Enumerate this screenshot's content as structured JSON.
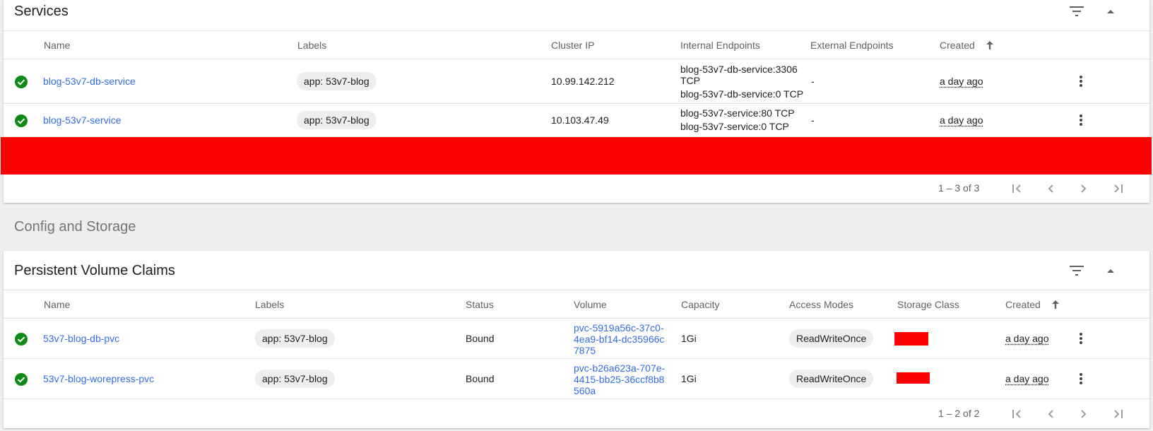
{
  "services": {
    "title": "Services",
    "columns": {
      "name": "Name",
      "labels": "Labels",
      "cluster_ip": "Cluster IP",
      "internal_endpoints": "Internal Endpoints",
      "external_endpoints": "External Endpoints",
      "created": "Created"
    },
    "rows": [
      {
        "name": "blog-53v7-db-service",
        "label": "app: 53v7-blog",
        "cluster_ip": "10.99.142.212",
        "internal_endpoint_1": "blog-53v7-db-service:3306 TCP",
        "internal_endpoint_2": "blog-53v7-db-service:0 TCP",
        "external_endpoints": "-",
        "created": "a day ago"
      },
      {
        "name": "blog-53v7-service",
        "label": "app: 53v7-blog",
        "cluster_ip": "10.103.47.49",
        "internal_endpoint_1": "blog-53v7-service:80 TCP",
        "internal_endpoint_2": "blog-53v7-service:0 TCP",
        "external_endpoints": "-",
        "created": "a day ago"
      }
    ],
    "pagination": "1 – 3 of 3"
  },
  "section_title": "Config and Storage",
  "pvc": {
    "title": "Persistent Volume Claims",
    "columns": {
      "name": "Name",
      "labels": "Labels",
      "status": "Status",
      "volume": "Volume",
      "capacity": "Capacity",
      "access_modes": "Access Modes",
      "storage_class": "Storage Class",
      "created": "Created"
    },
    "rows": [
      {
        "name": "53v7-blog-db-pvc",
        "label": "app: 53v7-blog",
        "status": "Bound",
        "volume": "pvc-5919a56c-37c0-4ea9-bf14-dc35966c7875",
        "capacity": "1Gi",
        "access_mode": "ReadWriteOnce",
        "created": "a day ago"
      },
      {
        "name": "53v7-blog-worepress-pvc",
        "label": "app: 53v7-blog",
        "status": "Bound",
        "volume": "pvc-b26a623a-707e-4415-bb25-36ccf8b8560a",
        "capacity": "1Gi",
        "access_mode": "ReadWriteOnce",
        "created": "a day ago"
      }
    ],
    "pagination": "1 – 2 of 2"
  },
  "icons": {
    "status": "check-circle-icon",
    "filter": "filter-icon",
    "collapse": "chevron-up-icon",
    "row_menu": "more-vert-icon",
    "sort": "arrow-up-icon",
    "first_page": "first-page-icon",
    "prev_page": "chevron-left-icon",
    "next_page": "chevron-right-icon",
    "last_page": "last-page-icon"
  },
  "colors": {
    "link": "#326de6",
    "status_ok": "#0e8a16",
    "redaction": "#ff0000",
    "page_bg": "#eeeeee"
  }
}
